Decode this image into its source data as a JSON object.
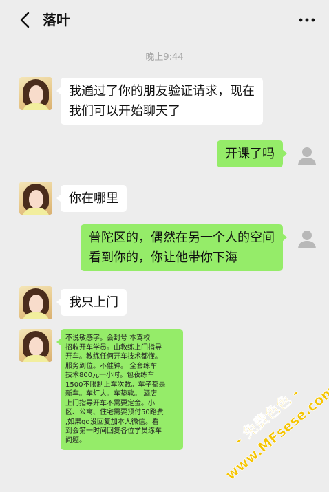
{
  "header": {
    "back_icon": "chevron-left-icon",
    "title": "落叶",
    "more_icon": "more-dots-icon"
  },
  "timestamp": "晚上9:44",
  "messages": [
    {
      "side": "left",
      "lines": [
        "我通过了你的朋友验证请求，现在",
        "我们可以开始聊天了"
      ]
    },
    {
      "side": "right",
      "lines": [
        "开课了吗"
      ]
    },
    {
      "side": "left",
      "lines": [
        "你在哪里"
      ]
    },
    {
      "side": "right",
      "lines": [
        "普陀区的，偶然在另一个人的空间",
        "看到你的，你让他带你下海"
      ]
    },
    {
      "side": "left",
      "lines": [
        "我只上门"
      ]
    },
    {
      "side": "left",
      "lines": [
        "不说敏感字。会封号    本驾校",
        "招收开车学员。由教练上门指导",
        "开车。教练任何开车技术都懂。",
        "服务到位。不催钟。   全套练车",
        "技术800元一小时。包夜练车",
        "1500不限制上车次数。车子都是",
        "新车。车灯大。车垫软。   酒店",
        "上门指导开车不需要定金。小",
        "区、公寓、住宅需要预付50路费",
        ",如果qq没回复加本人微信。看",
        "到会第一时间回复各位学员练车",
        "问题。"
      ]
    }
  ],
  "watermark": {
    "line1": "- 免费色色 -",
    "line2": "www.MFsese.com",
    "color": "#f5c400"
  },
  "colors": {
    "background": "#ededed",
    "bubble_sent": "#95ec69",
    "bubble_received": "#ffffff"
  }
}
